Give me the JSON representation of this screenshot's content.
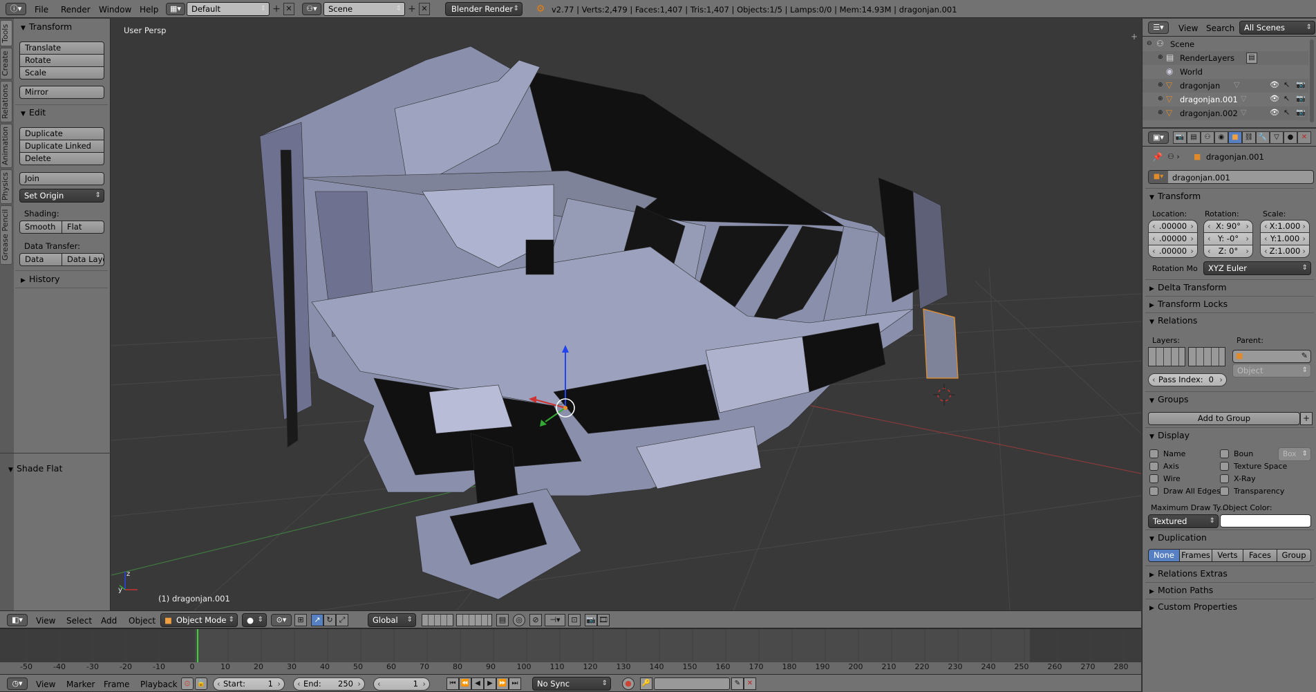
{
  "top_header": {
    "menus": [
      "File",
      "Render",
      "Window",
      "Help"
    ],
    "layout": "Default",
    "scene": "Scene",
    "engine": "Blender Render",
    "stats": "v2.77 | Verts:2,479 | Faces:1,407 | Tris:1,407 | Objects:1/5 | Lamps:0/0 | Mem:14.93M | dragonjan.001"
  },
  "tool_tabs": [
    "Tools",
    "Create",
    "Relations",
    "Animation",
    "Physics",
    "Grease Pencil"
  ],
  "tool_shelf": {
    "transform_header": "Transform",
    "translate": "Translate",
    "rotate": "Rotate",
    "scale": "Scale",
    "mirror": "Mirror",
    "edit_header": "Edit",
    "duplicate": "Duplicate",
    "duplicate_linked": "Duplicate Linked",
    "delete": "Delete",
    "join": "Join",
    "set_origin": "Set Origin",
    "shading_label": "Shading:",
    "smooth": "Smooth",
    "flat": "Flat",
    "data_transfer_label": "Data Transfer:",
    "data": "Data",
    "data_layout": "Data Layo",
    "history_header": "History",
    "operator_header": "Shade Flat"
  },
  "viewport": {
    "view_label": "User Persp",
    "object_label": "(1) dragonjan.001",
    "colors": {
      "bg": "#393939",
      "mesh_light": "#8e93b0",
      "mesh_dark": "#0d0d0d",
      "x_axis": "#cc3333",
      "y_axis": "#33aa33",
      "z_axis": "#2244ee"
    }
  },
  "view3d_header": {
    "menus": [
      "View",
      "Select",
      "Add",
      "Object"
    ],
    "mode": "Object Mode",
    "orientation": "Global"
  },
  "timeline": {
    "ticks": [
      "-50",
      "-40",
      "-30",
      "-20",
      "-10",
      "0",
      "10",
      "20",
      "30",
      "40",
      "50",
      "60",
      "70",
      "80",
      "90",
      "100",
      "110",
      "120",
      "130",
      "140",
      "150",
      "160",
      "170",
      "180",
      "190",
      "200",
      "210",
      "220",
      "230",
      "240",
      "250",
      "260",
      "270",
      "280"
    ],
    "menus": [
      "View",
      "Marker",
      "Frame",
      "Playback"
    ],
    "start": "Start:",
    "start_value": "1",
    "end": "End:",
    "end_value": "250",
    "current": "1",
    "sync": "No Sync"
  },
  "outliner": {
    "menus": [
      "View",
      "Search"
    ],
    "scope": "All Scenes",
    "items": [
      {
        "label": "Scene",
        "level": 0
      },
      {
        "label": "RenderLayers",
        "level": 1
      },
      {
        "label": "World",
        "level": 1
      },
      {
        "label": "dragonjan",
        "level": 1
      },
      {
        "label": "dragonjan.001",
        "level": 1,
        "selected": true
      },
      {
        "label": "dragonjan.002",
        "level": 1
      }
    ]
  },
  "properties": {
    "breadcrumb": "dragonjan.001",
    "object_name": "dragonjan.001",
    "transform_header": "Transform",
    "location_label": "Location:",
    "rotation_label": "Rotation:",
    "scale_label": "Scale:",
    "location": [
      ".00000",
      ".00000",
      ".00000"
    ],
    "rotation": [
      "X:  90°",
      "Y:  -0°",
      "Z:  0°"
    ],
    "scale": [
      "X:1.000",
      "Y:1.000",
      "Z:1.000"
    ],
    "rotation_mode_label": "Rotation Mo",
    "rotation_mode": "XYZ Euler",
    "delta_transform": "Delta Transform",
    "transform_locks": "Transform Locks",
    "relations_header": "Relations",
    "layers_label": "Layers:",
    "parent_label": "Parent:",
    "parent_type_placeholder": "Object",
    "pass_index_label": "Pass Index:",
    "pass_index": "0",
    "groups_header": "Groups",
    "add_to_group": "Add to Group",
    "display_header": "Display",
    "display_checks_left": [
      "Name",
      "Axis",
      "Wire",
      "Draw All Edges"
    ],
    "display_checks_right": [
      "Boun",
      "Texture Space",
      "X-Ray",
      "Transparency"
    ],
    "bounds_type": "Box",
    "max_draw_type_label": "Maximum Draw Ty...",
    "object_color_label": "Object Color:",
    "max_draw_type": "Textured",
    "object_color": "#ffffff",
    "duplication_header": "Duplication",
    "duplication_tabs": [
      "None",
      "Frames",
      "Verts",
      "Faces",
      "Group"
    ],
    "relations_extras": "Relations Extras",
    "motion_paths": "Motion Paths",
    "custom_properties": "Custom Properties"
  }
}
